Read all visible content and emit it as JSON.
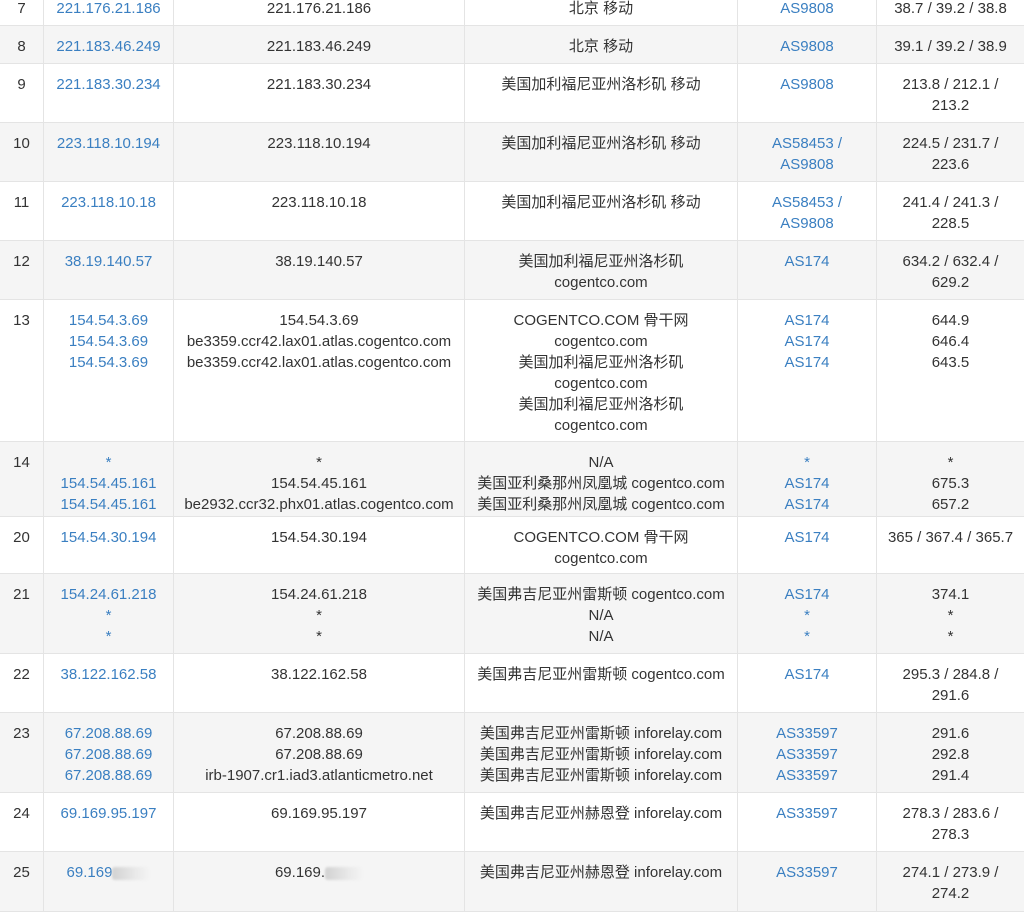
{
  "rows": [
    {
      "hop": "7",
      "ips": [
        "221.176.21.186"
      ],
      "hosts": [
        "221.176.21.186"
      ],
      "locs": [
        "北京 移动"
      ],
      "asns": [
        "AS9808"
      ],
      "lats": [
        "38.7 / 39.2 / 38.8"
      ]
    },
    {
      "hop": "8",
      "ips": [
        "221.183.46.249"
      ],
      "hosts": [
        "221.183.46.249"
      ],
      "locs": [
        "北京 移动"
      ],
      "asns": [
        "AS9808"
      ],
      "lats": [
        "39.1 / 39.2 / 38.9"
      ]
    },
    {
      "hop": "9",
      "ips": [
        "221.183.30.234"
      ],
      "hosts": [
        "221.183.30.234"
      ],
      "locs": [
        "美国加利福尼亚州洛杉矶 移动"
      ],
      "asns": [
        "AS9808"
      ],
      "lats": [
        "213.8 / 212.1 /",
        "213.2"
      ]
    },
    {
      "hop": "10",
      "ips": [
        "223.118.10.194"
      ],
      "hosts": [
        "223.118.10.194"
      ],
      "locs": [
        "美国加利福尼亚州洛杉矶 移动"
      ],
      "asns": [
        "AS58453 /",
        "AS9808"
      ],
      "lats": [
        "224.5 / 231.7 /",
        "223.6"
      ]
    },
    {
      "hop": "11",
      "ips": [
        "223.118.10.18"
      ],
      "hosts": [
        "223.118.10.18"
      ],
      "locs": [
        "美国加利福尼亚州洛杉矶 移动"
      ],
      "asns": [
        "AS58453 /",
        "AS9808"
      ],
      "lats": [
        "241.4 / 241.3 /",
        "228.5"
      ]
    },
    {
      "hop": "12",
      "ips": [
        "38.19.140.57"
      ],
      "hosts": [
        "38.19.140.57"
      ],
      "locs": [
        "美国加利福尼亚州洛杉矶",
        "cogentco.com"
      ],
      "asns": [
        "AS174"
      ],
      "lats": [
        "634.2 / 632.4 /",
        "629.2"
      ]
    },
    {
      "hop": "13",
      "ips": [
        "154.54.3.69",
        "154.54.3.69",
        "154.54.3.69"
      ],
      "hosts": [
        "154.54.3.69",
        "be3359.ccr42.lax01.atlas.cogentco.com",
        "be3359.ccr42.lax01.atlas.cogentco.com"
      ],
      "locs": [
        "COGENTCO.COM 骨干网",
        "cogentco.com",
        "美国加利福尼亚州洛杉矶",
        "cogentco.com",
        "美国加利福尼亚州洛杉矶",
        "cogentco.com"
      ],
      "asns": [
        "AS174",
        "AS174",
        "AS174"
      ],
      "lats": [
        "644.9",
        "646.4",
        "643.5"
      ]
    },
    {
      "hop": "14",
      "ips": [
        "*",
        "154.54.45.161",
        "154.54.45.161"
      ],
      "hosts": [
        "*",
        "154.54.45.161",
        "be2932.ccr32.phx01.atlas.cogentco.com"
      ],
      "locs": [
        "N/A",
        "美国亚利桑那州凤凰城 cogentco.com",
        "美国亚利桑那州凤凰城 cogentco.com"
      ],
      "asns": [
        "*",
        "AS174",
        "AS174"
      ],
      "lats": [
        "*",
        "675.3",
        "657.2"
      ]
    },
    {
      "hop": "20",
      "ips": [
        "154.54.30.194"
      ],
      "hosts": [
        "154.54.30.194"
      ],
      "locs": [
        "COGENTCO.COM 骨干网",
        "cogentco.com"
      ],
      "asns": [
        "AS174"
      ],
      "lats": [
        "365 / 367.4 / 365.7"
      ]
    },
    {
      "hop": "21",
      "ips": [
        "154.24.61.218",
        "*",
        "*"
      ],
      "hosts": [
        "154.24.61.218",
        "*",
        "*"
      ],
      "locs": [
        "美国弗吉尼亚州雷斯顿 cogentco.com",
        "N/A",
        "N/A"
      ],
      "asns": [
        "AS174",
        "*",
        "*"
      ],
      "lats": [
        "374.1",
        "*",
        "*"
      ]
    },
    {
      "hop": "22",
      "ips": [
        "38.122.162.58"
      ],
      "hosts": [
        "38.122.162.58"
      ],
      "locs": [
        "美国弗吉尼亚州雷斯顿 cogentco.com"
      ],
      "asns": [
        "AS174"
      ],
      "lats": [
        "295.3 / 284.8 /",
        "291.6"
      ]
    },
    {
      "hop": "23",
      "ips": [
        "67.208.88.69",
        "67.208.88.69",
        "67.208.88.69"
      ],
      "hosts": [
        "67.208.88.69",
        "67.208.88.69",
        "irb-1907.cr1.iad3.atlanticmetro.net"
      ],
      "locs": [
        "美国弗吉尼亚州雷斯顿 inforelay.com",
        "美国弗吉尼亚州雷斯顿 inforelay.com",
        "美国弗吉尼亚州雷斯顿 inforelay.com"
      ],
      "asns": [
        "AS33597",
        "AS33597",
        "AS33597"
      ],
      "lats": [
        "291.6",
        "292.8",
        "291.4"
      ]
    },
    {
      "hop": "24",
      "ips": [
        "69.169.95.197"
      ],
      "hosts": [
        "69.169.95.197"
      ],
      "locs": [
        "美国弗吉尼亚州赫恩登 inforelay.com"
      ],
      "asns": [
        "AS33597"
      ],
      "lats": [
        "278.3 / 283.6 /",
        "278.3"
      ]
    },
    {
      "hop": "25",
      "ips": [
        "69.169"
      ],
      "hosts": [
        "69.169."
      ],
      "locs": [
        "美国弗吉尼亚州赫恩登 inforelay.com"
      ],
      "asns": [
        "AS33597"
      ],
      "lats": [
        "274.1 / 273.9 /",
        "274.2"
      ]
    }
  ]
}
